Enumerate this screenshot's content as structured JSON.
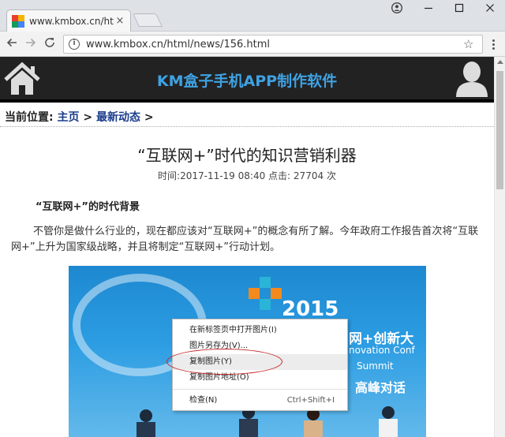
{
  "browser": {
    "tab_title": "www.kmbox.cn/html/n",
    "tab_close": "×",
    "url": "www.kmbox.cn/html/news/156.html",
    "icons": [
      "back-icon",
      "forward-icon",
      "reload-icon",
      "info-icon",
      "star-icon",
      "menu-icon",
      "account-icon",
      "minimize-icon",
      "maximize-icon",
      "close-icon"
    ]
  },
  "header": {
    "site_title": "KM盒子手机APP制作软件",
    "title_color": "#3fa2e3",
    "bg_color": "#222222"
  },
  "breadcrumb": {
    "prefix": "当前位置:",
    "home": "主页",
    "sep": ">",
    "section": "最新动态",
    "trail": ">"
  },
  "article": {
    "title": "“互联网+”时代的知识营销利器",
    "time_label": "时间:",
    "time": "2017-11-19 08:40",
    "clicks_label": "点击:",
    "clicks": "27704",
    "clicks_unit": "次",
    "subheading": "“互联网+”的时代背景",
    "paragraph": "不管你是做什么行业的，现在都应该对“互联网+”的概念有所了解。今年政府工作报告首次将“互联网+”上升为国家级战略，并且将制定“互联网+”行动计划。"
  },
  "photo": {
    "year": "2015",
    "line1": "网+创新大",
    "line2": "novation Conf",
    "line3": "Summit",
    "line4": "高峰对话"
  },
  "context_menu": {
    "items": [
      {
        "label": "在新标签页中打开图片(I)",
        "shortcut": ""
      },
      {
        "label": "图片另存为(V)...",
        "shortcut": ""
      },
      {
        "label": "复制图片(Y)",
        "shortcut": ""
      },
      {
        "label": "复制图片地址(O)",
        "shortcut": ""
      },
      {
        "label": "检查(N)",
        "shortcut": "Ctrl+Shift+I"
      }
    ],
    "highlight_color": "#c52a2a"
  }
}
